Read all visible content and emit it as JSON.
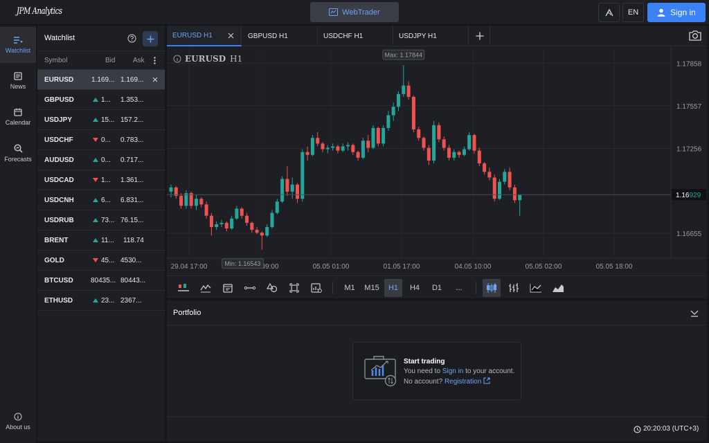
{
  "header": {
    "logo": "JPM Analytics",
    "webtrader_label": "WebTrader",
    "language": "EN",
    "signin_label": "Sign in"
  },
  "nav": {
    "items": [
      {
        "label": "Watchlist",
        "icon": "watchlist-icon"
      },
      {
        "label": "News",
        "icon": "news-icon"
      },
      {
        "label": "Calendar",
        "icon": "calendar-icon"
      },
      {
        "label": "Forecasts",
        "icon": "forecasts-icon"
      }
    ],
    "about_label": "About us"
  },
  "watchlist": {
    "title": "Watchlist",
    "columns": {
      "symbol": "Symbol",
      "bid": "Bid",
      "ask": "Ask"
    },
    "rows": [
      {
        "symbol": "EURUSD",
        "dir": "",
        "bid": "1.169...",
        "ask": "1.169..."
      },
      {
        "symbol": "GBPUSD",
        "dir": "up",
        "bid": "1...",
        "ask": "1.353..."
      },
      {
        "symbol": "USDJPY",
        "dir": "up",
        "bid": "15...",
        "ask": "157.2..."
      },
      {
        "symbol": "USDCHF",
        "dir": "down",
        "bid": "0...",
        "ask": "0.783..."
      },
      {
        "symbol": "AUDUSD",
        "dir": "up",
        "bid": "0...",
        "ask": "0.717..."
      },
      {
        "symbol": "USDCAD",
        "dir": "down",
        "bid": "1...",
        "ask": "1.361..."
      },
      {
        "symbol": "USDCNH",
        "dir": "up",
        "bid": "6...",
        "ask": "6.831..."
      },
      {
        "symbol": "USDRUB",
        "dir": "up",
        "bid": "73...",
        "ask": "76.15..."
      },
      {
        "symbol": "BRENT",
        "dir": "up",
        "bid": "11...",
        "ask": "118.74"
      },
      {
        "symbol": "GOLD",
        "dir": "down",
        "bid": "45...",
        "ask": "4530..."
      },
      {
        "symbol": "BTCUSD",
        "dir": "",
        "bid": "80435...",
        "ask": "80443..."
      },
      {
        "symbol": "ETHUSD",
        "dir": "up",
        "bid": "23...",
        "ask": "2367..."
      }
    ]
  },
  "tabs": [
    "EURUSD H1",
    "GBPUSD H1",
    "USDCHF H1",
    "USDJPY H1"
  ],
  "chart": {
    "symbol": "EURUSD",
    "timeframe": "H1",
    "max_label": "Max: 1.17844",
    "min_label": "Min: 1.16543",
    "price_axis": [
      "1.17858",
      "1.17557",
      "1.17256",
      "1.16655"
    ],
    "current_price": "1.16929",
    "time_axis": [
      "29.04 17:00",
      "30.04 09:00",
      "05.05 01:00",
      "01.05 17:00",
      "04.05 10:00",
      "05.05 02:00",
      "05.05 18:00"
    ]
  },
  "chart_data": {
    "type": "candlestick",
    "x_ticks": [
      "29.04 17:00",
      "30.04 09:00",
      "05.05 01:00",
      "01.05 17:00",
      "04.05 10:00",
      "05.05 02:00",
      "05.05 18:00"
    ],
    "y_ticks": [
      1.17858,
      1.17557,
      1.17256,
      1.16655
    ],
    "max": 1.17844,
    "min": 1.16543,
    "last": 1.16929,
    "candles": [
      [
        1.1695,
        1.17,
        1.1691,
        1.1698
      ],
      [
        1.1698,
        1.1699,
        1.169,
        1.1692
      ],
      [
        1.1692,
        1.1694,
        1.1683,
        1.1685
      ],
      [
        1.1685,
        1.1696,
        1.1683,
        1.1694
      ],
      [
        1.1694,
        1.1695,
        1.1683,
        1.1685
      ],
      [
        1.1685,
        1.1693,
        1.1682,
        1.169
      ],
      [
        1.169,
        1.1691,
        1.1684,
        1.1686
      ],
      [
        1.1686,
        1.1688,
        1.1676,
        1.1678
      ],
      [
        1.1678,
        1.168,
        1.1664,
        1.167
      ],
      [
        1.167,
        1.1674,
        1.1668,
        1.1672
      ],
      [
        1.1672,
        1.1675,
        1.167,
        1.1673
      ],
      [
        1.1673,
        1.1674,
        1.1667,
        1.1669
      ],
      [
        1.1669,
        1.1678,
        1.1668,
        1.1676
      ],
      [
        1.1676,
        1.1685,
        1.1675,
        1.1683
      ],
      [
        1.1683,
        1.1684,
        1.1676,
        1.1678
      ],
      [
        1.1678,
        1.168,
        1.1671,
        1.1673
      ],
      [
        1.1673,
        1.1674,
        1.1666,
        1.1668
      ],
      [
        1.1668,
        1.167,
        1.1665,
        1.1666
      ],
      [
        1.1666,
        1.1667,
        1.1654,
        1.1664
      ],
      [
        1.1664,
        1.1672,
        1.1663,
        1.167
      ],
      [
        1.167,
        1.1682,
        1.1669,
        1.168
      ],
      [
        1.168,
        1.169,
        1.1679,
        1.1688
      ],
      [
        1.1688,
        1.1706,
        1.1687,
        1.1704
      ],
      [
        1.1704,
        1.1713,
        1.1692,
        1.1695
      ],
      [
        1.1695,
        1.1705,
        1.169,
        1.17
      ],
      [
        1.17,
        1.1701,
        1.1687,
        1.169
      ],
      [
        1.169,
        1.1725,
        1.1688,
        1.1723
      ],
      [
        1.1723,
        1.1727,
        1.1717,
        1.1721
      ],
      [
        1.1721,
        1.1735,
        1.172,
        1.1733
      ],
      [
        1.1733,
        1.1737,
        1.1727,
        1.1729
      ],
      [
        1.1729,
        1.173,
        1.1723,
        1.1725
      ],
      [
        1.1725,
        1.1728,
        1.1722,
        1.1726
      ],
      [
        1.1726,
        1.1729,
        1.1724,
        1.1727
      ],
      [
        1.1727,
        1.1728,
        1.1722,
        1.1724
      ],
      [
        1.1724,
        1.1729,
        1.1723,
        1.1727
      ],
      [
        1.1727,
        1.173,
        1.1724,
        1.1728
      ],
      [
        1.1728,
        1.1729,
        1.1721,
        1.1723
      ],
      [
        1.1723,
        1.1724,
        1.1717,
        1.1719
      ],
      [
        1.1719,
        1.1733,
        1.1718,
        1.1731
      ],
      [
        1.1731,
        1.1735,
        1.1723,
        1.1726
      ],
      [
        1.1726,
        1.1742,
        1.1725,
        1.174
      ],
      [
        1.174,
        1.1741,
        1.1727,
        1.1729
      ],
      [
        1.1729,
        1.1742,
        1.1727,
        1.174
      ],
      [
        1.174,
        1.1752,
        1.1738,
        1.1749
      ],
      [
        1.1749,
        1.1758,
        1.1745,
        1.1755
      ],
      [
        1.1755,
        1.1766,
        1.1752,
        1.1764
      ],
      [
        1.1764,
        1.17844,
        1.1762,
        1.177
      ],
      [
        1.177,
        1.1773,
        1.176,
        1.1762
      ],
      [
        1.1762,
        1.1763,
        1.1737,
        1.1739
      ],
      [
        1.1739,
        1.1741,
        1.1731,
        1.1733
      ],
      [
        1.1733,
        1.1734,
        1.1724,
        1.1726
      ],
      [
        1.1726,
        1.1728,
        1.1714,
        1.1717
      ],
      [
        1.1717,
        1.1745,
        1.1715,
        1.1742
      ],
      [
        1.1742,
        1.1744,
        1.173,
        1.1732
      ],
      [
        1.1732,
        1.1734,
        1.1724,
        1.1726
      ],
      [
        1.1726,
        1.1728,
        1.1717,
        1.1719
      ],
      [
        1.1719,
        1.1725,
        1.1717,
        1.1723
      ],
      [
        1.1723,
        1.1724,
        1.1719,
        1.1721
      ],
      [
        1.1721,
        1.1727,
        1.172,
        1.1725
      ],
      [
        1.1725,
        1.1737,
        1.1724,
        1.1735
      ],
      [
        1.1735,
        1.1736,
        1.1722,
        1.1724
      ],
      [
        1.1724,
        1.1726,
        1.1713,
        1.1715
      ],
      [
        1.1715,
        1.1716,
        1.1707,
        1.1709
      ],
      [
        1.1709,
        1.1712,
        1.1703,
        1.1705
      ],
      [
        1.1705,
        1.1707,
        1.1688,
        1.169
      ],
      [
        1.169,
        1.1704,
        1.1689,
        1.1702
      ],
      [
        1.1702,
        1.1711,
        1.17,
        1.1709
      ],
      [
        1.1709,
        1.1712,
        1.1696,
        1.1698
      ],
      [
        1.1698,
        1.17,
        1.1687,
        1.1689
      ],
      [
        1.1689,
        1.169,
        1.1678,
        1.16929
      ]
    ]
  },
  "timeframes": [
    "M1",
    "M15",
    "H1",
    "H4",
    "D1",
    "..."
  ],
  "timeframe_active": "H1",
  "portfolio": {
    "title": "Portfolio",
    "card_title": "Start trading",
    "card_line1_pre": "You need to ",
    "card_line1_link": "Sign in",
    "card_line1_post": " to your account.",
    "card_line2_pre": "No account? ",
    "card_line2_link": "Registration"
  },
  "clock": "20:20:03 (UTC+3)",
  "colors": {
    "up": "#26a69a",
    "down": "#ef5350",
    "accent": "#3b82f6"
  }
}
